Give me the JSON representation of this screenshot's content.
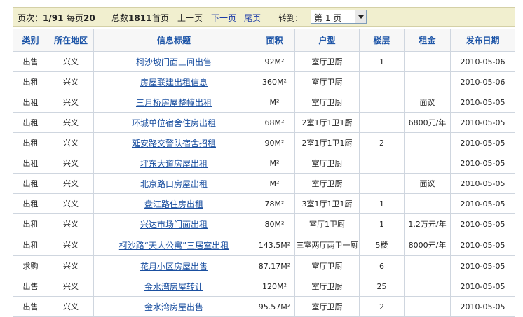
{
  "pager": {
    "page_info_label": "页次：",
    "page_value": "1/91",
    "per_page_label": "每页",
    "per_page_value": "20",
    "total_label": "总数",
    "total_value": "1811",
    "first": "首页",
    "prev": "上一页",
    "next": "下一页",
    "last": "尾页",
    "goto": "转到:",
    "page_select_value": "第 1 页"
  },
  "columns": [
    "类别",
    "所在地区",
    "信息标题",
    "面积",
    "户型",
    "楼层",
    "租金",
    "发布日期"
  ],
  "rows": [
    {
      "type": "出售",
      "area": "兴义",
      "title": "柯沙坡门面三间出售",
      "size": "92M²",
      "layout": "室厅卫厨",
      "floor": "1",
      "rent": "",
      "date": "2010-05-06"
    },
    {
      "type": "出租",
      "area": "兴义",
      "title": "房屋联建出租信息",
      "size": "360M²",
      "layout": "室厅卫厨",
      "floor": "",
      "rent": "",
      "date": "2010-05-06"
    },
    {
      "type": "出租",
      "area": "兴义",
      "title": "三月桥房屋整幢出租",
      "size": "M²",
      "layout": "室厅卫厨",
      "floor": "",
      "rent": "面议",
      "date": "2010-05-05"
    },
    {
      "type": "出租",
      "area": "兴义",
      "title": "环城单位宿舍住房出租",
      "size": "68M²",
      "layout": "2室1厅1卫1厨",
      "floor": "",
      "rent": "6800元/年",
      "date": "2010-05-05"
    },
    {
      "type": "出租",
      "area": "兴义",
      "title": "延安路交警队宿舍招租",
      "size": "90M²",
      "layout": "2室1厅1卫1厨",
      "floor": "2",
      "rent": "",
      "date": "2010-05-05"
    },
    {
      "type": "出租",
      "area": "兴义",
      "title": "坪东大道房屋出租",
      "size": "M²",
      "layout": "室厅卫厨",
      "floor": "",
      "rent": "",
      "date": "2010-05-05"
    },
    {
      "type": "出租",
      "area": "兴义",
      "title": "北京路口房屋出租",
      "size": "M²",
      "layout": "室厅卫厨",
      "floor": "",
      "rent": "面议",
      "date": "2010-05-05"
    },
    {
      "type": "出租",
      "area": "兴义",
      "title": "盘江路住房出租",
      "size": "78M²",
      "layout": "3室1厅1卫1厨",
      "floor": "1",
      "rent": "",
      "date": "2010-05-05"
    },
    {
      "type": "出租",
      "area": "兴义",
      "title": "兴达市场门面出租",
      "size": "80M²",
      "layout": "室厅1卫厨",
      "floor": "1",
      "rent": "1.2万元/年",
      "date": "2010-05-05"
    },
    {
      "type": "出租",
      "area": "兴义",
      "title": "柯沙路“天人公寓”三居室出租",
      "size": "143.5M²",
      "layout": "三室两厅两卫一厨",
      "floor": "5楼",
      "rent": "8000元/年",
      "date": "2010-05-05"
    },
    {
      "type": "求购",
      "area": "兴义",
      "title": "花月小区房屋出售",
      "size": "87.17M²",
      "layout": "室厅卫厨",
      "floor": "6",
      "rent": "",
      "date": "2010-05-05"
    },
    {
      "type": "出售",
      "area": "兴义",
      "title": "金水湾房屋转让",
      "size": "120M²",
      "layout": "室厅卫厨",
      "floor": "25",
      "rent": "",
      "date": "2010-05-05"
    },
    {
      "type": "出售",
      "area": "兴义",
      "title": "金水湾房屋出售",
      "size": "95.57M²",
      "layout": "室厅卫厨",
      "floor": "2",
      "rent": "",
      "date": "2010-05-05"
    }
  ]
}
